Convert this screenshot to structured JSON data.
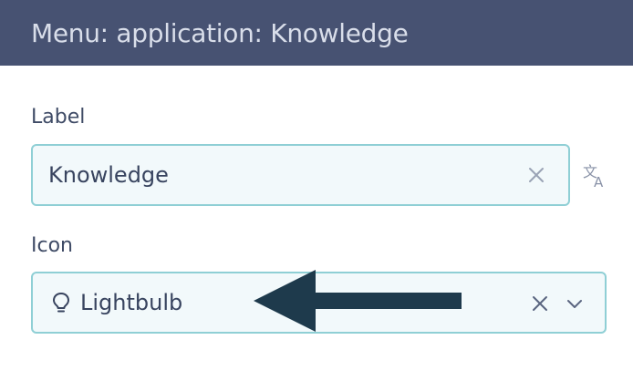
{
  "header": {
    "title": "Menu: application: Knowledge"
  },
  "label_field": {
    "label": "Label",
    "value": "Knowledge",
    "clear_icon": "close-icon",
    "translate_icon": "translate-icon"
  },
  "icon_field": {
    "label": "Icon",
    "value": "Lightbulb",
    "value_icon": "lightbulb-icon",
    "clear_icon": "close-icon",
    "dropdown_icon": "chevron-down-icon"
  },
  "annotation": {
    "arrow_icon": "arrow-left-icon",
    "color": "#1e3a4c"
  },
  "colors": {
    "header_bg": "#475272",
    "input_bg": "#f2f9fb",
    "input_border": "#8fcfd5",
    "text": "#38445f"
  }
}
